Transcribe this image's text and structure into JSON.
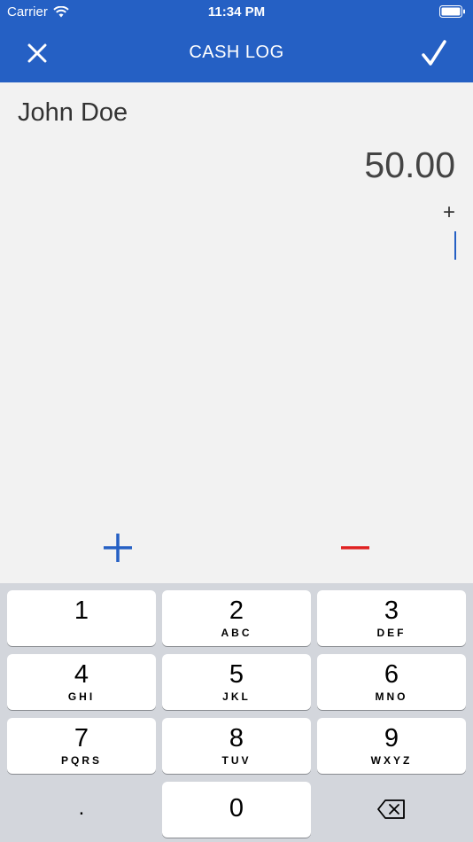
{
  "status_bar": {
    "carrier": "Carrier",
    "time": "11:34 PM"
  },
  "navbar": {
    "title": "CASH LOG",
    "close_icon": "close-icon",
    "confirm_icon": "checkmark-icon",
    "color": "#2560c4"
  },
  "entry": {
    "name": "John Doe",
    "amount": "50.00",
    "operator": "+"
  },
  "actions": {
    "add_color": "#2560c4",
    "subtract_color": "#e02020"
  },
  "keypad": {
    "keys": [
      {
        "digit": "1",
        "letters": ""
      },
      {
        "digit": "2",
        "letters": "ABC"
      },
      {
        "digit": "3",
        "letters": "DEF"
      },
      {
        "digit": "4",
        "letters": "GHI"
      },
      {
        "digit": "5",
        "letters": "JKL"
      },
      {
        "digit": "6",
        "letters": "MNO"
      },
      {
        "digit": "7",
        "letters": "PQRS"
      },
      {
        "digit": "8",
        "letters": "TUV"
      },
      {
        "digit": "9",
        "letters": "WXYZ"
      }
    ],
    "decimal": ".",
    "zero": "0",
    "delete_icon": "backspace-icon"
  }
}
